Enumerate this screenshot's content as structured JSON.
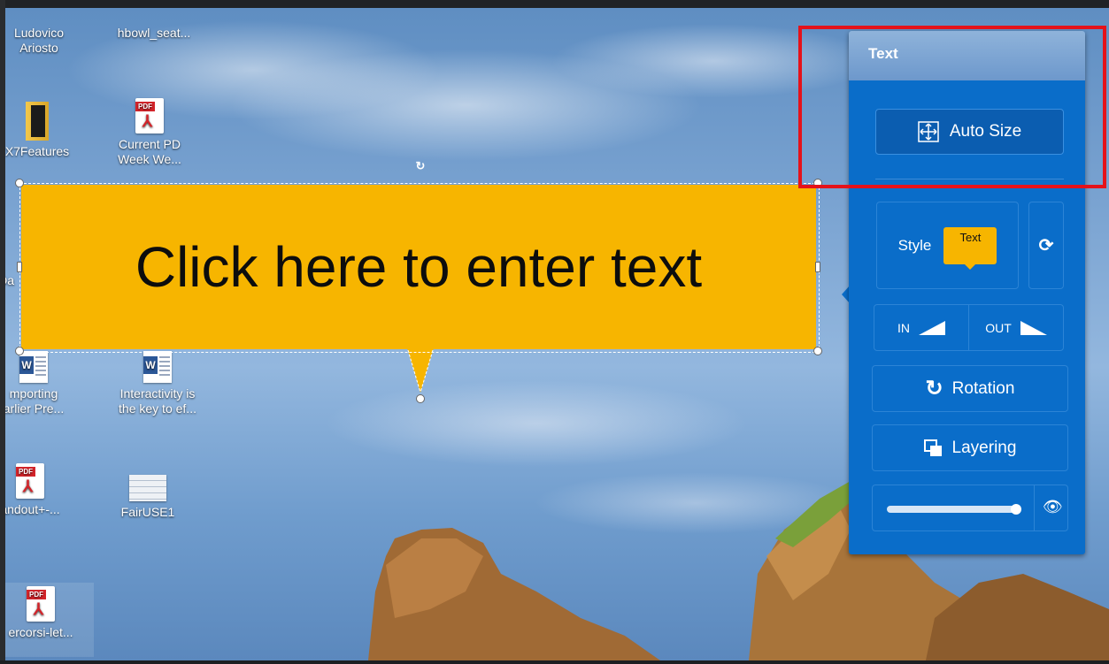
{
  "desktop_icons": [
    {
      "id": "ludovico",
      "label_line1": "Ludovico",
      "label_line2": "Ariosto",
      "type": "file"
    },
    {
      "id": "hbowl",
      "label_line1": "hbowl_seat...",
      "label_line2": "",
      "type": "file"
    },
    {
      "id": "x7",
      "label_line1": "X7Features",
      "label_line2": "",
      "type": "folder"
    },
    {
      "id": "currentpd",
      "label_line1": "Current PD",
      "label_line2": "Week We...",
      "type": "pdf"
    },
    {
      "id": "importing",
      "label_line1": "mporting",
      "label_line2": "arlier Pre...",
      "type": "word"
    },
    {
      "id": "interactivity",
      "label_line1": "Interactivity is",
      "label_line2": "the key to ef...",
      "type": "word"
    },
    {
      "id": "handout",
      "label_line1": "andout+-...",
      "label_line2": "",
      "type": "pdf"
    },
    {
      "id": "fairuse",
      "label_line1": "FairUSE1",
      "label_line2": "",
      "type": "doc"
    },
    {
      "id": "percorsi",
      "label_line1": "ercorsi-let...",
      "label_line2": "",
      "type": "pdf"
    },
    {
      "id": "partial_da",
      "label_line1": "Da",
      "label_line2": "",
      "type": "partial"
    }
  ],
  "icon_glyphs": {
    "pdf_tag": "PDF",
    "word_letter": "W",
    "pdf_swirl": "⅄"
  },
  "callout": {
    "text": "Click here to enter text",
    "color": "#f7b500"
  },
  "panel": {
    "title": "Text",
    "auto_size_label": "Auto Size",
    "style_label": "Style",
    "style_preview_text": "Text",
    "in_label": "IN",
    "out_label": "OUT",
    "rotation_label": "Rotation",
    "layering_label": "Layering",
    "opacity_level": 0.95
  },
  "colors": {
    "panel_bg": "#0a6dc9",
    "highlight": "#e5121a",
    "callout": "#f7b500"
  }
}
